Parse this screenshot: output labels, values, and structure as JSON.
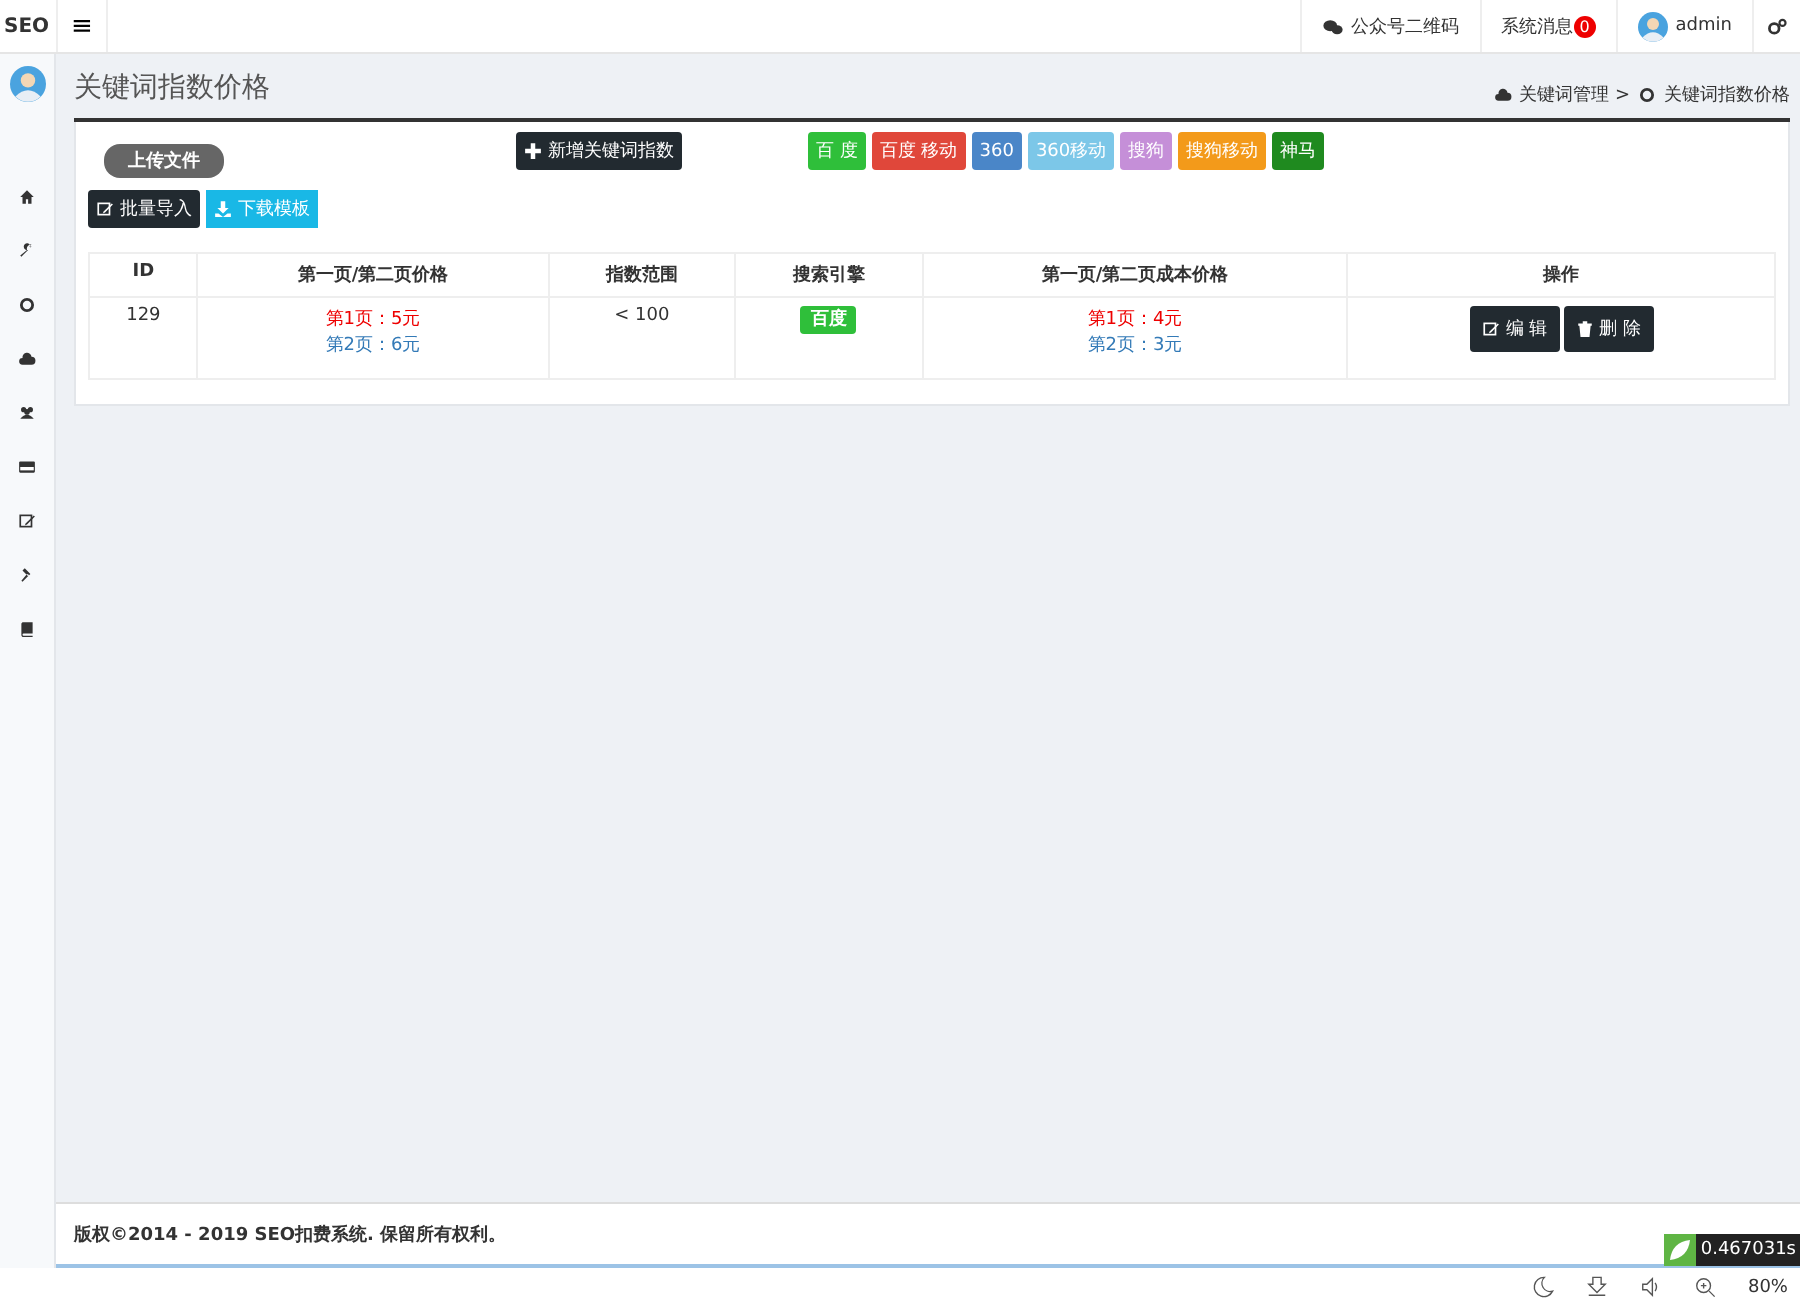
{
  "header": {
    "brand": "SEO",
    "menu_toggle": "≡",
    "links": [
      {
        "kind": "wechat",
        "label": "公众号二维码"
      },
      {
        "kind": "messages",
        "label": "系统消息",
        "badge": "0"
      },
      {
        "kind": "user",
        "label": "admin"
      }
    ]
  },
  "page": {
    "title": "关键词指数价格",
    "breadcrumb": [
      "关键词管理 >",
      "关键词指数价格"
    ]
  },
  "toolbar": {
    "upload": "上传文件",
    "add": "新增关键词指数",
    "engines": [
      {
        "label": "百 度",
        "color": "#2fbf3a"
      },
      {
        "label": "百度 移动",
        "color": "#e0473a"
      },
      {
        "label": "360",
        "color": "#4a86c8"
      },
      {
        "label": "360移动",
        "color": "#7cc7e8"
      },
      {
        "label": "搜狗",
        "color": "#c58fd8"
      },
      {
        "label": "搜狗移动",
        "color": "#f39a1a"
      },
      {
        "label": "神马",
        "color": "#1f8a1f"
      }
    ],
    "import": "批量导入",
    "download": "下载模板"
  },
  "table": {
    "columns": [
      "ID",
      "第一页/第二页价格",
      "指数范围",
      "搜索引擎",
      "第一页/第二页成本价格",
      "操作"
    ],
    "rows": [
      {
        "id": "129",
        "price1": "第1页：5元",
        "price2": "第2页：6元",
        "range": "< 100",
        "engine": "百度",
        "cost1": "第1页：4元",
        "cost2": "第2页：3元",
        "actions": [
          "编 辑",
          "删 除"
        ]
      }
    ]
  },
  "footer": {
    "copyright": "版权©2014 - 2019 SEO扣费系统. 保留所有权利。",
    "timer": "0.467031s"
  },
  "status_bar": {
    "zoom": "80%"
  }
}
